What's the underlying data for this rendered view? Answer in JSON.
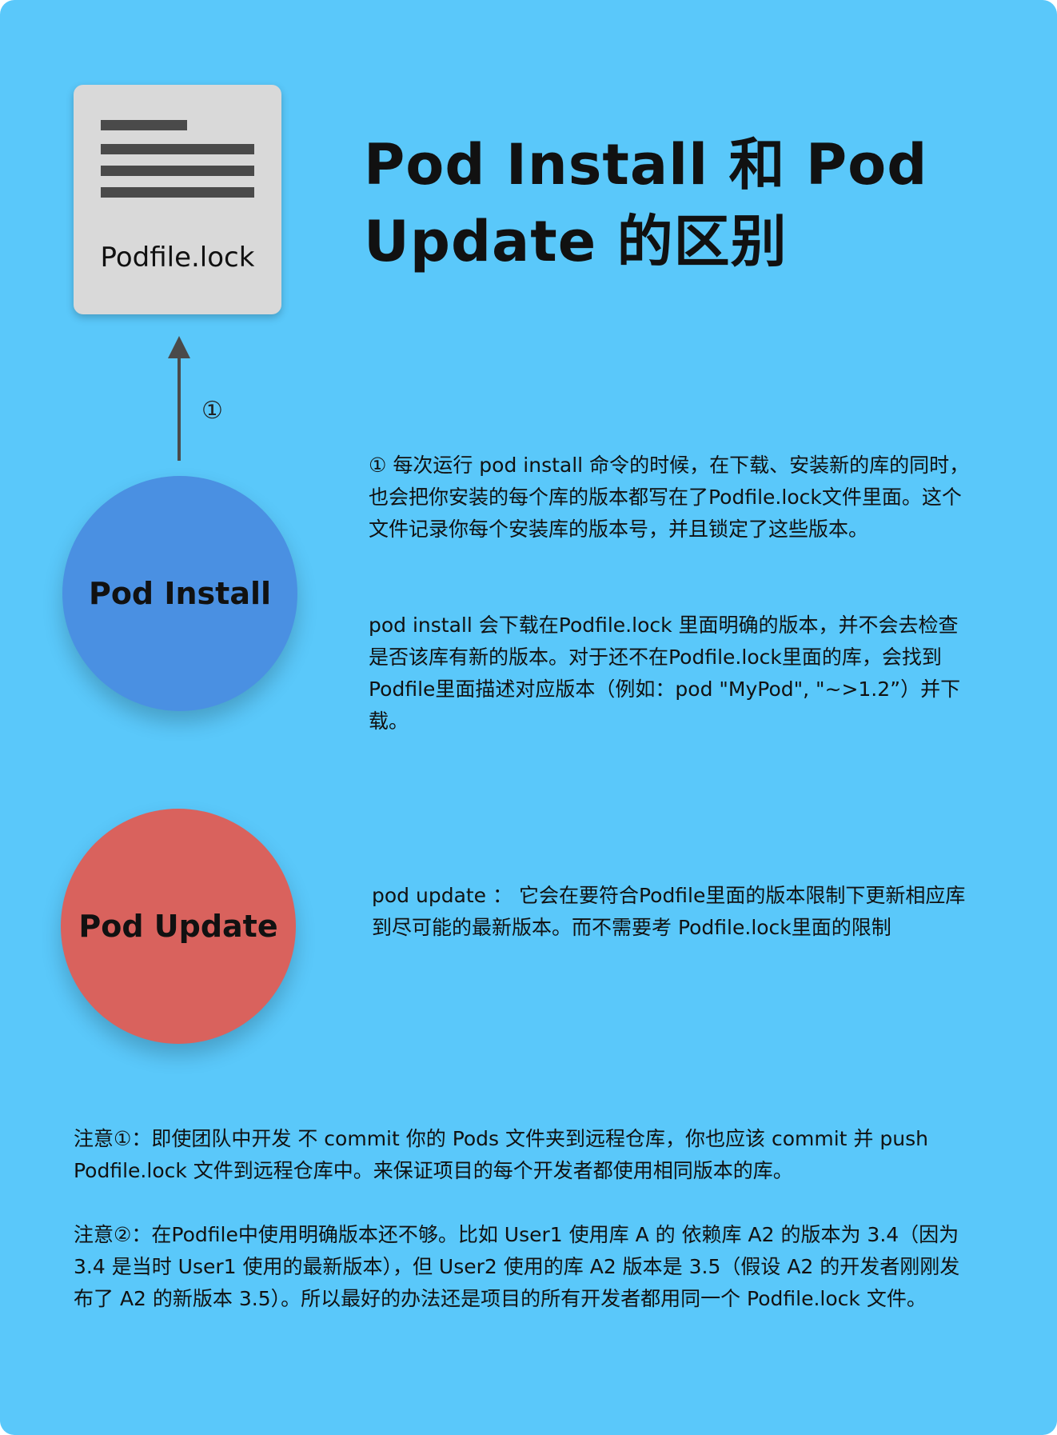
{
  "file_card": {
    "name": "Podfile.lock"
  },
  "title": {
    "line1": "Pod Install 和 Pod",
    "line2": "Update 的区别"
  },
  "arrow": {
    "label": "①"
  },
  "nodes": {
    "install": "Pod Install",
    "update": "Pod Update"
  },
  "text": {
    "install_note": "① 每次运行 pod install 命令的时候，在下载、安装新的库的同时，也会把你安装的每个库的版本都写在了Podfile.lock文件里面。这个文件记录你每个安装库的版本号，并且锁定了这些版本。",
    "install_detail": "pod install 会下载在Podfile.lock 里面明确的版本，并不会去检查是否该库有新的版本。对于还不在Podfile.lock里面的库，会找到Podfile里面描述对应版本（例如：pod \"MyPod\", \"~>1.2”）并下载。",
    "update_note": "pod update ： 它会在要符合Podfile里面的版本限制下更新相应库到尽可能的最新版本。而不需要考 Podfile.lock里面的限制",
    "notice1": "注意①：即使团队中开发 不 commit 你的 Pods 文件夹到远程仓库，你也应该 commit 并 push Podfile.lock 文件到远程仓库中。来保证项目的每个开发者都使用相同版本的库。",
    "notice2": "注意②：在Podfile中使用明确版本还不够。比如 User1 使用库 A 的 依赖库 A2 的版本为 3.4（因为 3.4 是当时 User1 使用的最新版本），但 User2 使用的库 A2 版本是 3.5（假设 A2 的开发者刚刚发布了 A2 的新版本 3.5）。所以最好的办法还是项目的所有开发者都用同一个 Podfile.lock 文件。"
  },
  "colors": {
    "background": "#5ac8fa",
    "card": "#d9d9d9",
    "install_circle": "#4a90e2",
    "update_circle": "#d9625d",
    "arrow": "#4a4a4a"
  }
}
